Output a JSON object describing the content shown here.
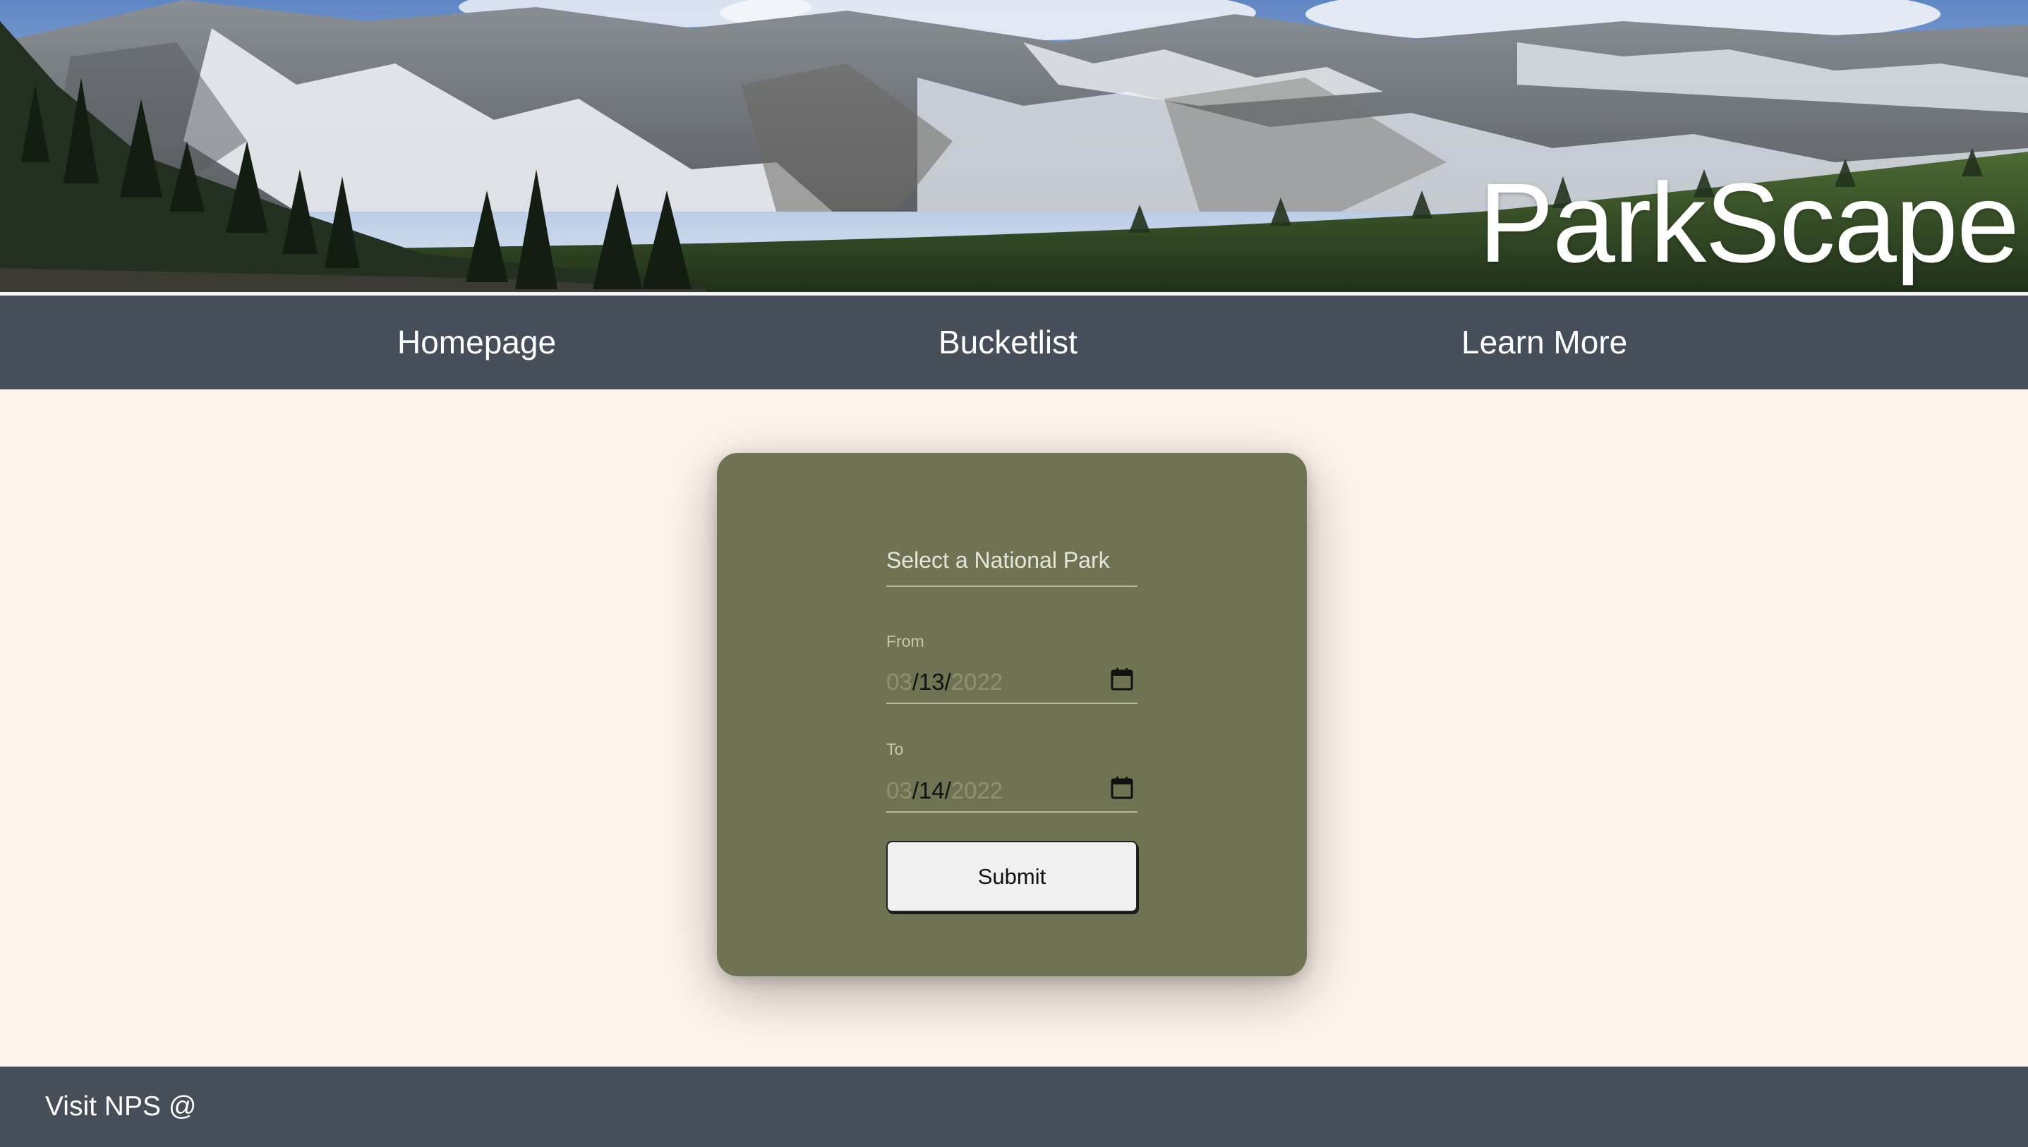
{
  "header": {
    "brand": "ParkScape"
  },
  "nav": {
    "items": [
      {
        "label": "Homepage"
      },
      {
        "label": "Bucketlist"
      },
      {
        "label": "Learn More"
      }
    ]
  },
  "form": {
    "park_select_placeholder": "Select a National Park",
    "from": {
      "label": "From",
      "month": "03",
      "day": "13",
      "year": "2022",
      "sep": "/"
    },
    "to": {
      "label": "To",
      "month": "03",
      "day": "14",
      "year": "2022",
      "sep": "/"
    },
    "submit_label": "Submit"
  },
  "footer": {
    "text": "Visit NPS @"
  },
  "colors": {
    "nav_bg": "#454e59",
    "page_bg": "#fdf5ee",
    "card_bg": "#707351",
    "button_bg": "#f0f0f0"
  },
  "icons": {
    "date_picker": "calendar-icon"
  }
}
